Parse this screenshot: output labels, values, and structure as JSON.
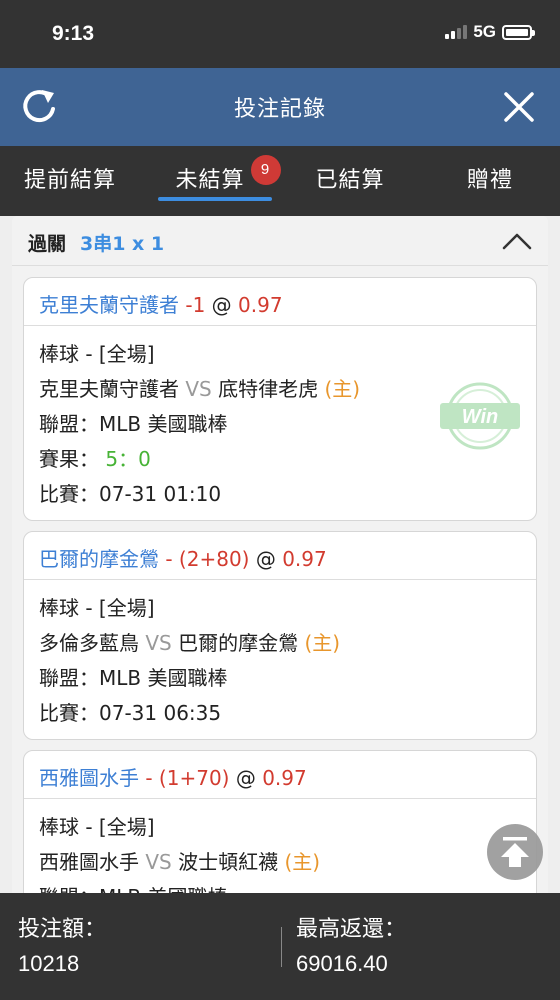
{
  "status": {
    "time": "9:13",
    "network": "5G"
  },
  "header": {
    "title": "投注記錄",
    "refresh_icon": "refresh-icon",
    "close_icon": "close-icon"
  },
  "tabs": [
    {
      "label": "提前結算",
      "active": false
    },
    {
      "label": "未結算",
      "active": true,
      "badge": "9"
    },
    {
      "label": "已結算",
      "active": false
    },
    {
      "label": "贈禮",
      "active": false
    }
  ],
  "parlay": {
    "label": "過關",
    "type": "3串1 x 1"
  },
  "bets": [
    {
      "team": "克里夫蘭守護者",
      "handicap": " -1",
      "at": " @ ",
      "odds": "0.97",
      "sport": "棒球 - [全場]",
      "home_team_left": "克里夫蘭守護者",
      "vs": " VS ",
      "away_team": "底特律老虎",
      "home_mark": " (主)",
      "league_label": "聯盟：",
      "league": "MLB 美國職棒",
      "result_label": "賽果：",
      "result": " 5：0",
      "match_label": "比賽：",
      "match_time": "07-31 01:10",
      "status_stamp": "Win"
    },
    {
      "team": "巴爾的摩金鶯",
      "handicap": " - (2+80)",
      "at": " @ ",
      "odds": "0.97",
      "sport": "棒球 - [全場]",
      "home_team_left": "多倫多藍鳥",
      "vs": " VS ",
      "away_team": "巴爾的摩金鶯",
      "home_mark": " (主)",
      "league_label": "聯盟：",
      "league": "MLB 美國職棒",
      "match_label": "比賽：",
      "match_time": "07-31 06:35"
    },
    {
      "team": "西雅圖水手",
      "handicap": " - (1+70)",
      "at": " @ ",
      "odds": "0.97",
      "sport": "棒球 - [全場]",
      "home_team_left": "西雅圖水手",
      "vs": " VS ",
      "away_team": "波士頓紅襪",
      "home_mark": " (主)",
      "league_label": "聯盟：",
      "league": "MLB 美國職棒"
    }
  ],
  "footer": {
    "stake_label": "投注額：",
    "stake_value": "10218",
    "max_return_label": "最高返還：",
    "max_return_value": "69016.40"
  },
  "colors": {
    "header_bg": "#3f6494",
    "dark_bg": "#333333",
    "accent_blue": "#3d8de0",
    "odds_red": "#d23b2f",
    "home_orange": "#e8962c",
    "win_green": "#47b336"
  }
}
